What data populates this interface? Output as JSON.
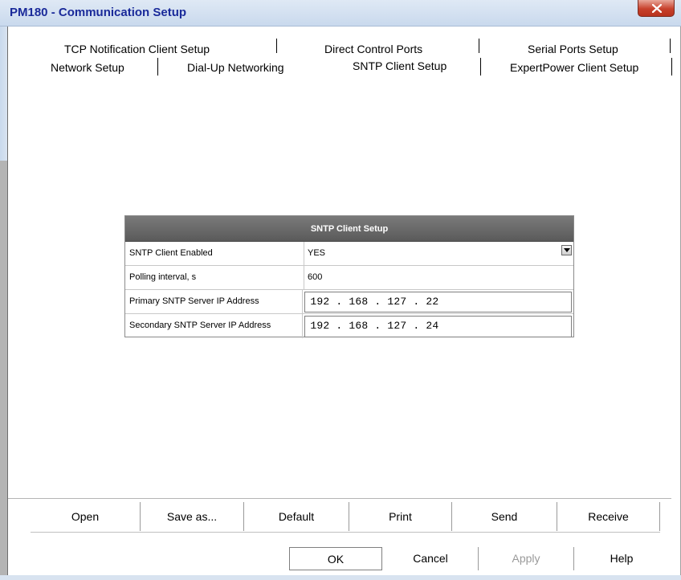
{
  "window": {
    "title": "PM180 - Communication Setup",
    "close_glyph": "X"
  },
  "tabs": {
    "row_top": [
      {
        "label": "TCP Notification Client Setup"
      },
      {
        "label": "Direct Control Ports"
      },
      {
        "label": "Serial Ports Setup"
      }
    ],
    "row_bottom": [
      {
        "label": "Network Setup"
      },
      {
        "label": "Dial-Up Networking"
      },
      {
        "label": "SNTP Client Setup",
        "selected": true
      },
      {
        "label": "ExpertPower Client Setup"
      }
    ]
  },
  "sntp_table": {
    "header": "SNTP Client Setup",
    "rows": [
      {
        "label": "SNTP Client Enabled",
        "value": "YES",
        "control": "dropdown"
      },
      {
        "label": "Polling interval, s",
        "value": "600",
        "control": "text"
      },
      {
        "label": "Primary SNTP Server IP Address",
        "value": "192 . 168 . 127 . 22",
        "control": "ip"
      },
      {
        "label": "Secondary SNTP Server IP Address",
        "value": "192 . 168 . 127 . 24",
        "control": "ip"
      }
    ]
  },
  "toolbar": {
    "open": "Open",
    "save_as": "Save as...",
    "default": "Default",
    "print": "Print",
    "send": "Send",
    "receive": "Receive"
  },
  "dialog_buttons": {
    "ok": "OK",
    "cancel": "Cancel",
    "apply": "Apply",
    "help": "Help"
  },
  "colors": {
    "title_text": "#1a2a9a",
    "table_header_bg": "#6a6a6a",
    "close_button": "#c7412c"
  }
}
